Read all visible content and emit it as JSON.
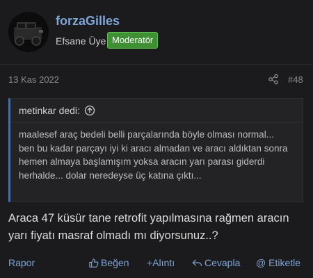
{
  "post": {
    "author": "forzaGilles",
    "user_title": "Efsane Üye",
    "role_badge": "Moderatör",
    "date": "13 Kas 2022",
    "post_number": "#48",
    "quote": {
      "author_line": "metinkar dedi:",
      "text": "maalesef araç bedeli belli parçalarında böyle olması normal...\nben bu kadar parçayı iyi ki aracı almadan ve aracı aldıktan sonra hemen almaya başlamışım yoksa aracın yarı parası giderdi herhalde... dolar neredeyse üç katına çıktı..."
    },
    "body": "Araca 47 küsür tane retrofit yapılmasına rağmen aracın yarı fiyatı masraf olmadı mı diyorsunuz..?"
  },
  "actions": {
    "report": "Rapor",
    "like": "Beğen",
    "quote": "+Alıntı",
    "reply": "Cevapla",
    "tag": "@ Etiketle"
  },
  "colors": {
    "background": "#1b1b1d",
    "link": "#7fa6d8",
    "badge": "#3f8f35"
  },
  "icons": [
    "avatar-car-image",
    "share-icon",
    "jump-to-quote-icon",
    "thumbs-up-icon",
    "reply-arrow-icon"
  ]
}
